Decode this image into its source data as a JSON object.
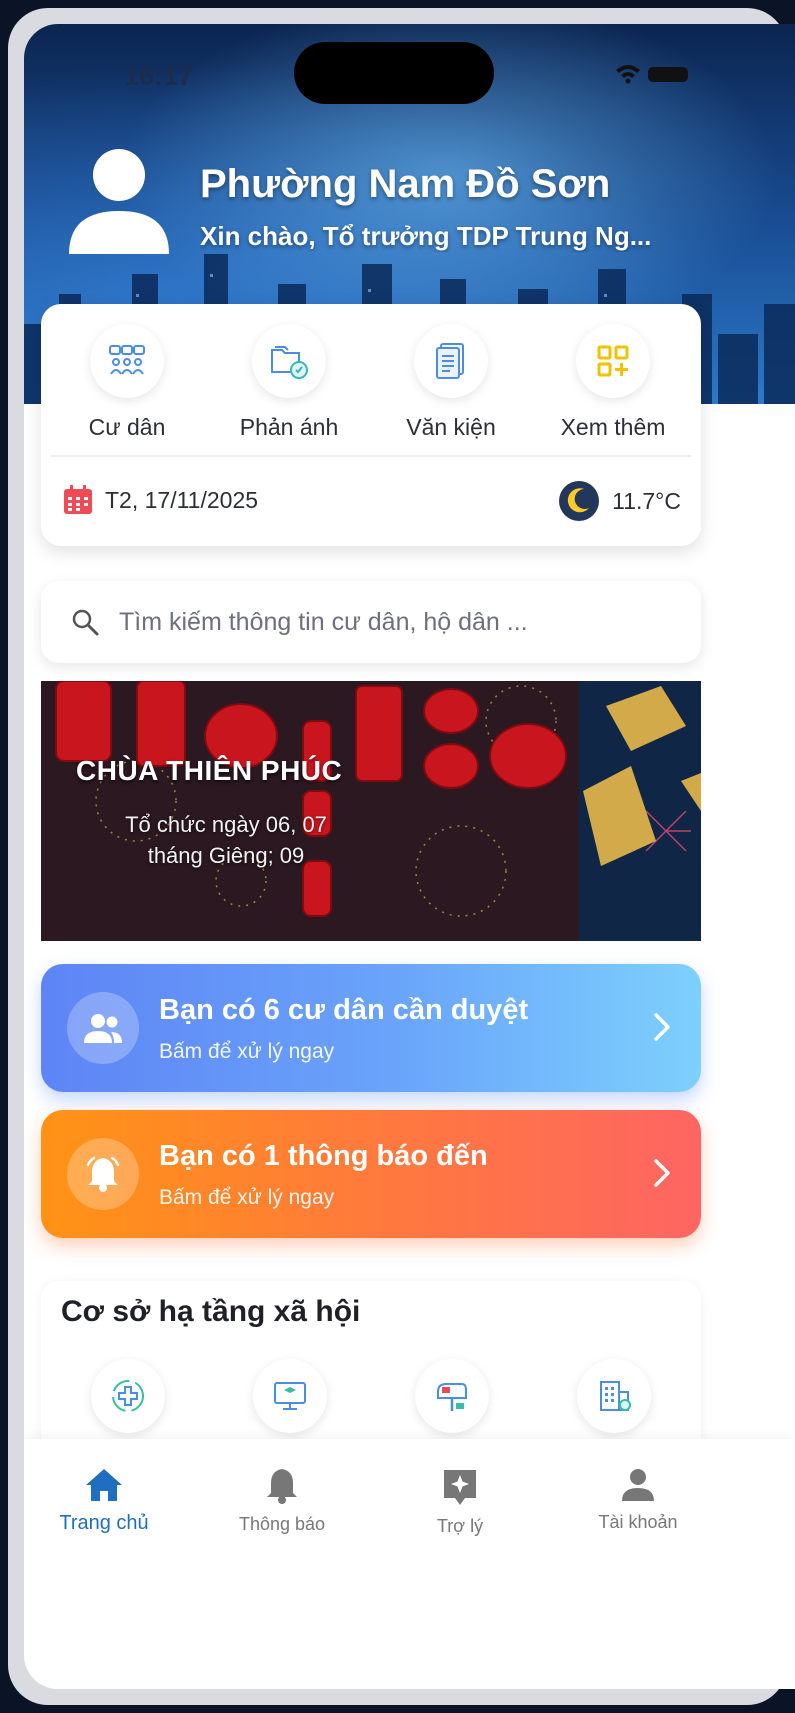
{
  "status_bar": {
    "time": "16:17"
  },
  "header": {
    "title": "Phường Nam Đồ Sơn",
    "subtitle": "Xin chào, Tổ trưởng TDP Trung Ng..."
  },
  "quick_actions": [
    {
      "label": "Cư dân",
      "icon": "residents-icon"
    },
    {
      "label": "Phản ánh",
      "icon": "feedback-folder-icon"
    },
    {
      "label": "Văn kiện",
      "icon": "document-icon"
    },
    {
      "label": "Xem thêm",
      "icon": "grid-plus-icon"
    }
  ],
  "date_weather": {
    "date": "T2, 17/11/2025",
    "temperature": "11.7°C"
  },
  "search": {
    "placeholder": "Tìm kiếm thông tin cư dân, hộ dân ..."
  },
  "banner": {
    "title": "CHÙA THIÊN PHÚC",
    "description": "Tổ chức ngày 06, 07 tháng Giêng; 09"
  },
  "alerts": [
    {
      "title": "Bạn có 6 cư dân cần duyệt",
      "subtitle": "Bấm để xử lý ngay",
      "icon": "people-icon"
    },
    {
      "title": "Bạn có 1 thông báo đến",
      "subtitle": "Bấm để xử lý ngay",
      "icon": "bell-icon"
    }
  ],
  "infrastructure": {
    "title": "Cơ sở hạ tầng xã hội",
    "items": [
      "medical-icon",
      "education-icon",
      "mailbox-icon",
      "building-icon"
    ]
  },
  "bottom_nav": [
    {
      "label": "Trang chủ",
      "icon": "home-icon",
      "active": true
    },
    {
      "label": "Thông báo",
      "icon": "bell-icon",
      "active": false
    },
    {
      "label": "Trợ lý",
      "icon": "assistant-icon",
      "active": false
    },
    {
      "label": "Tài khoản",
      "icon": "account-icon",
      "active": false
    }
  ],
  "colors": {
    "primary": "#1e6fc0",
    "alert_blue_start": "#5e84f5",
    "alert_blue_end": "#7dd0fd",
    "alert_orange_start": "#ff9315",
    "alert_orange_end": "#fe6563"
  }
}
